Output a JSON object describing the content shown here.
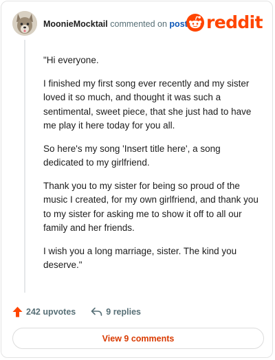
{
  "header": {
    "username": "MoonieMocktail",
    "commented_text": "commented on",
    "post_link": "post",
    "brand": "reddit",
    "avatar_icon": "wolf-avatar-icon",
    "brand_color": "#ff4500"
  },
  "comment": {
    "paragraphs": [
      "\"Hi everyone.",
      "I finished my first song ever recently and my sister loved it so much, and thought it was such a sentimental, sweet piece, that she just had to have me play it here today for you all.",
      "So here's my song 'Insert title here', a song dedicated to my girlfriend.",
      "Thank you to my sister for being so proud of the music I created, for my own girlfriend, and thank you to my sister for asking me to show it off to all our family and her friends.",
      "I wish you a long marriage, sister. The kind you deserve.\""
    ]
  },
  "actions": {
    "upvotes": "242 upvotes",
    "replies": "9 replies",
    "upvote_icon": "upvote-arrow-icon",
    "reply_icon": "reply-arrow-icon"
  },
  "footer": {
    "view_comments": "View 9 comments"
  }
}
